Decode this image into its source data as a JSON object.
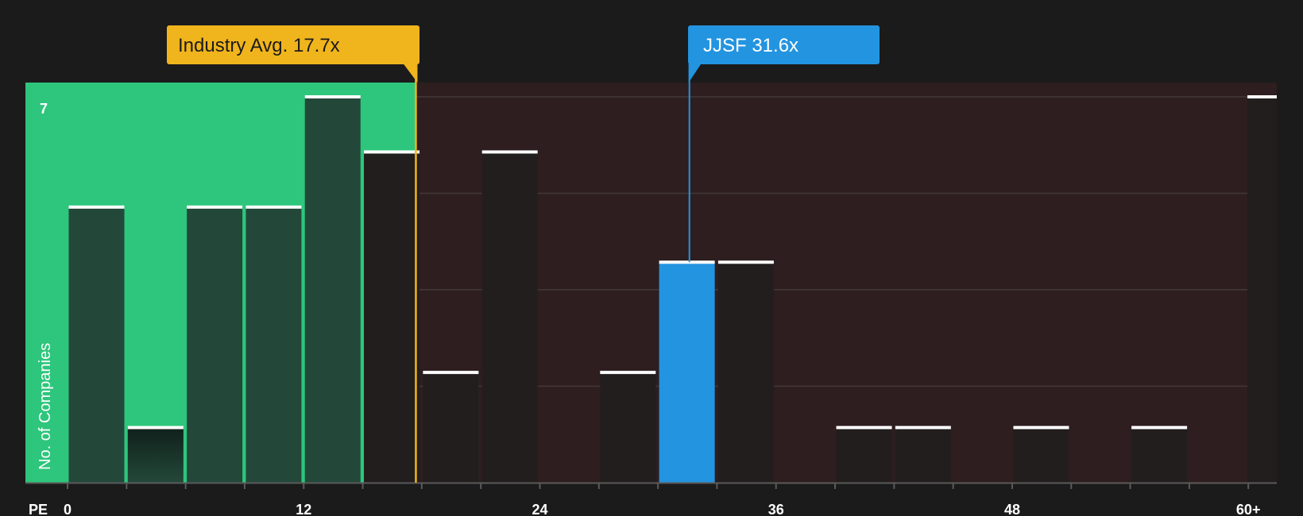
{
  "chart_data": {
    "type": "bar",
    "xlabel": "PE",
    "ylabel": "No. of Companies",
    "x_ticks": [
      "0",
      "12",
      "24",
      "36",
      "48",
      "60+"
    ],
    "x_range": [
      0,
      60
    ],
    "y_range": [
      0,
      7
    ],
    "y_tick_labels": [
      "7"
    ],
    "bin_width": 3,
    "bins": [
      {
        "start": 0,
        "value": 5
      },
      {
        "start": 3,
        "value": 1
      },
      {
        "start": 6,
        "value": 5
      },
      {
        "start": 9,
        "value": 5
      },
      {
        "start": 12,
        "value": 7
      },
      {
        "start": 15,
        "value": 6
      },
      {
        "start": 18,
        "value": 2
      },
      {
        "start": 21,
        "value": 6
      },
      {
        "start": 24,
        "value": 0
      },
      {
        "start": 27,
        "value": 2
      },
      {
        "start": 30,
        "value": 4,
        "highlight": true
      },
      {
        "start": 33,
        "value": 4
      },
      {
        "start": 36,
        "value": 0
      },
      {
        "start": 39,
        "value": 1
      },
      {
        "start": 42,
        "value": 1
      },
      {
        "start": 45,
        "value": 0
      },
      {
        "start": 48,
        "value": 1
      },
      {
        "start": 51,
        "value": 0
      },
      {
        "start": 54,
        "value": 1
      },
      {
        "start": 57,
        "value": 0
      },
      {
        "start": 60,
        "value": 7,
        "overflow": true
      }
    ],
    "markers": [
      {
        "label": "Industry Avg. 17.7x",
        "value": 17.7,
        "color": "#f0b41d"
      },
      {
        "label": "JJSF 31.6x",
        "value": 31.6,
        "color": "#2394e0"
      }
    ],
    "grid": true,
    "colors": {
      "background": "#1b1b1b",
      "below_avg_region": "#2dc67c",
      "above_avg_region": "#2e1e1f",
      "bar_in_green": "#23483a",
      "bar_dark": "#221e1e",
      "bar_highlight": "#2394e0",
      "bar_top": "#ffffff",
      "gridline": "#443838",
      "axis": "#5a5a5a"
    }
  }
}
